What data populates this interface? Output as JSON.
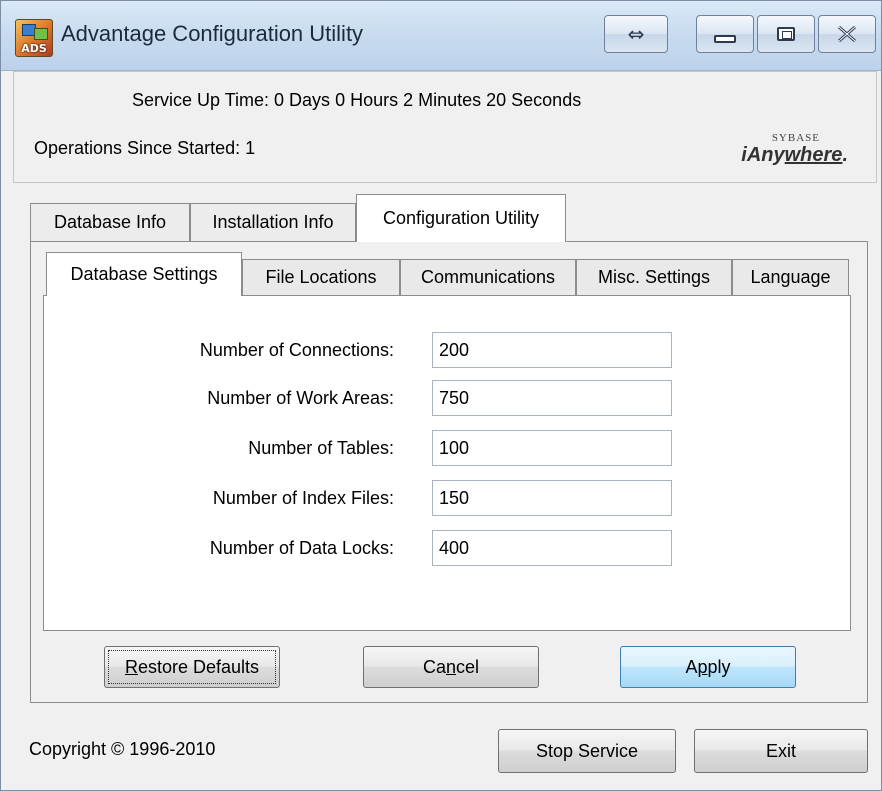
{
  "window": {
    "title": "Advantage Configuration Utility",
    "icon_label": "ADS"
  },
  "title_buttons": {
    "swap_glyph": "⇔"
  },
  "status": {
    "uptime_text": "Service Up Time: 0 Days 0 Hours 2 Minutes 20 Seconds",
    "operations_text": "Operations Since Started: 1",
    "logo_sybase": "SYBASE",
    "logo_i": "i",
    "logo_any": "Any",
    "logo_where": "where",
    "logo_dot": "."
  },
  "outer_tabs": [
    {
      "label": "Database Info"
    },
    {
      "label": "Installation Info"
    },
    {
      "label": "Configuration Utility",
      "active": true
    }
  ],
  "inner_tabs": [
    {
      "label": "Database Settings",
      "active": true
    },
    {
      "label": "File Locations"
    },
    {
      "label": "Communications"
    },
    {
      "label": "Misc. Settings"
    },
    {
      "label": "Language"
    }
  ],
  "fields": [
    {
      "label": "Number of Connections:",
      "value": "200"
    },
    {
      "label": "Number of Work Areas:",
      "value": "750"
    },
    {
      "label": "Number of Tables:",
      "value": "100"
    },
    {
      "label": "Number of Index Files:",
      "value": "150"
    },
    {
      "label": "Number of Data Locks:",
      "value": "400"
    }
  ],
  "buttons": {
    "restore_mnemonic": "R",
    "restore_rest": "estore Defaults",
    "cancel_pre": "Ca",
    "cancel_mnemonic": "n",
    "cancel_post": "cel",
    "apply_pre": "A",
    "apply_mnemonic": "p",
    "apply_post": "ply",
    "stop_service": "Stop Service",
    "exit": "Exit"
  },
  "footer": {
    "copyright": "Copyright © 1996-2010"
  }
}
